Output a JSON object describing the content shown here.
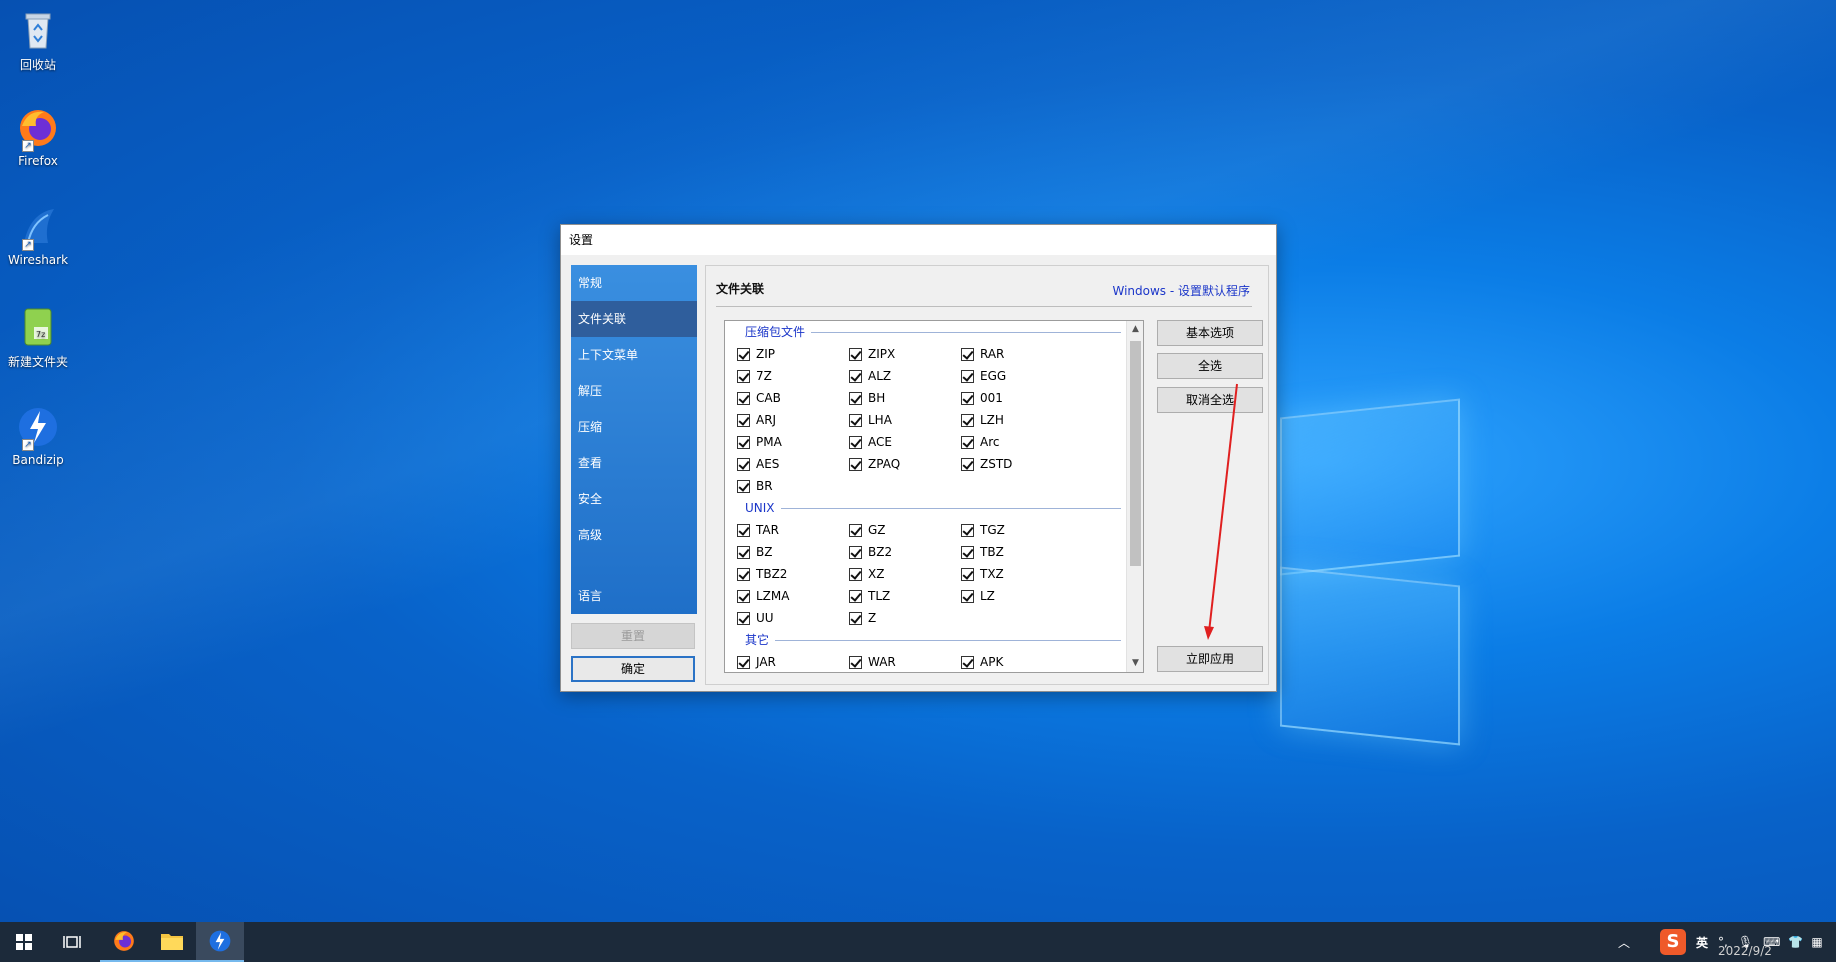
{
  "desktop": {
    "icons": [
      {
        "label": "回收站",
        "icon": "recycle-bin-icon"
      },
      {
        "label": "Firefox",
        "icon": "firefox-icon"
      },
      {
        "label": "Wireshark",
        "icon": "wireshark-icon"
      },
      {
        "label": "新建文件夹",
        "icon": "folder-archive-icon"
      },
      {
        "label": "Bandizip",
        "icon": "bandizip-icon"
      }
    ]
  },
  "dialog": {
    "title": "设置",
    "sidebar": {
      "items": [
        "常规",
        "文件关联",
        "上下文菜单",
        "解压",
        "压缩",
        "查看",
        "安全",
        "高级"
      ],
      "active": "文件关联",
      "language": "语言"
    },
    "reset_button": "重置",
    "ok_button": "确定",
    "panel": {
      "title": "文件关联",
      "link": "Windows - 设置默认程序",
      "groups": [
        {
          "name": "压缩包文件",
          "rows": [
            [
              "ZIP",
              "ZIPX",
              "RAR"
            ],
            [
              "7Z",
              "ALZ",
              "EGG"
            ],
            [
              "CAB",
              "BH",
              "001"
            ],
            [
              "ARJ",
              "LHA",
              "LZH"
            ],
            [
              "PMA",
              "ACE",
              "Arc"
            ],
            [
              "AES",
              "ZPAQ",
              "ZSTD"
            ],
            [
              "BR"
            ]
          ]
        },
        {
          "name": "UNIX",
          "rows": [
            [
              "TAR",
              "GZ",
              "TGZ"
            ],
            [
              "BZ",
              "BZ2",
              "TBZ"
            ],
            [
              "TBZ2",
              "XZ",
              "TXZ"
            ],
            [
              "LZMA",
              "TLZ",
              "LZ"
            ],
            [
              "UU",
              "Z"
            ]
          ]
        },
        {
          "name": "其它",
          "rows": [
            [
              "JAR",
              "WAR",
              "APK"
            ]
          ]
        }
      ],
      "buttons": {
        "basic": "基本选项",
        "select_all": "全选",
        "deselect_all": "取消全选",
        "apply": "立即应用"
      }
    }
  },
  "annotation": {
    "color": "#e02020"
  },
  "taskbar": {
    "items": [
      "start-icon",
      "task-view-icon",
      "firefox-icon",
      "file-explorer-icon",
      "bandizip-icon"
    ],
    "tray": {
      "ime": "英",
      "date": "2022/9/2"
    }
  }
}
